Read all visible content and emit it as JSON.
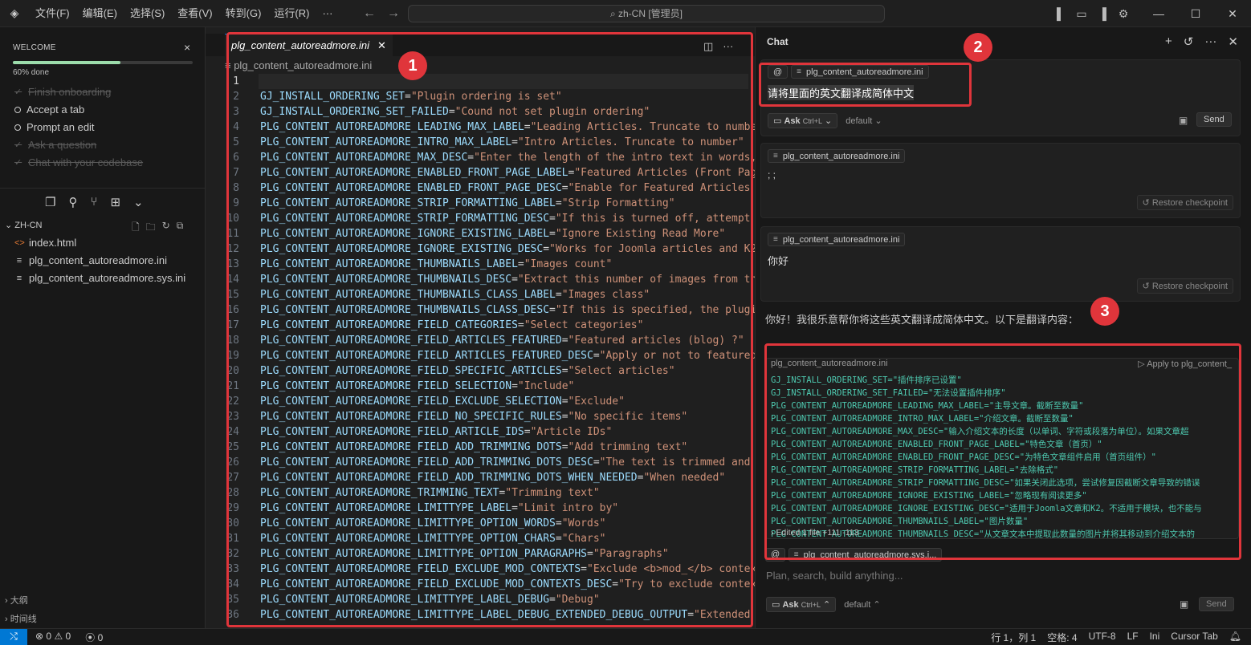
{
  "titlebar": {
    "menus": [
      "文件(F)",
      "编辑(E)",
      "选择(S)",
      "查看(V)",
      "转到(G)",
      "运行(R)",
      "···"
    ],
    "search": "zh-CN [管理员]"
  },
  "welcome": {
    "title": "WELCOME",
    "progress_label": "60% done",
    "progress_fraction": 0.6,
    "steps": [
      {
        "label": "Finish onboarding",
        "done": true
      },
      {
        "label": "Accept a tab",
        "done": false
      },
      {
        "label": "Prompt an edit",
        "done": false
      },
      {
        "label": "Ask a question",
        "done": true
      },
      {
        "label": "Chat with your codebase",
        "done": true
      }
    ]
  },
  "explorer": {
    "folder": "ZH-CN",
    "files": [
      {
        "name": "index.html",
        "icon": "html-icon"
      },
      {
        "name": "plg_content_autoreadmore.ini",
        "icon": "ini-file-icon"
      },
      {
        "name": "plg_content_autoreadmore.sys.ini",
        "icon": "ini-file-icon"
      }
    ],
    "outline": "大纲",
    "timeline": "时间线"
  },
  "editor": {
    "tab": "plg_content_autoreadmore.ini",
    "breadcrumb": "plg_content_autoreadmore.ini",
    "lines": [
      [
        "",
        ""
      ],
      [
        "GJ_INSTALL_ORDERING_SET",
        "\"Plugin ordering is set\""
      ],
      [
        "GJ_INSTALL_ORDERING_SET_FAILED",
        "\"Cound not set plugin ordering\""
      ],
      [
        "PLG_CONTENT_AUTOREADMORE_LEADING_MAX_LABEL",
        "\"Leading Articles. Truncate to numbe"
      ],
      [
        "PLG_CONTENT_AUTOREADMORE_INTRO_MAX_LABEL",
        "\"Intro Articles. Truncate to number\""
      ],
      [
        "PLG_CONTENT_AUTOREADMORE_MAX_DESC",
        "\"Enter the length of the intro text in words,"
      ],
      [
        "PLG_CONTENT_AUTOREADMORE_ENABLED_FRONT_PAGE_LABEL",
        "\"Featured Articles (Front Pag"
      ],
      [
        "PLG_CONTENT_AUTOREADMORE_ENABLED_FRONT_PAGE_DESC",
        "\"Enable for Featured Articles"
      ],
      [
        "PLG_CONTENT_AUTOREADMORE_STRIP_FORMATTING_LABEL",
        "\"Strip Formatting\""
      ],
      [
        "PLG_CONTENT_AUTOREADMORE_STRIP_FORMATTING_DESC",
        "\"If this is turned off, attempt"
      ],
      [
        "PLG_CONTENT_AUTOREADMORE_IGNORE_EXISTING_LABEL",
        "\"Ignore Existing Read More\""
      ],
      [
        "PLG_CONTENT_AUTOREADMORE_IGNORE_EXISTING_DESC",
        "\"Works for Joomla articles and K2"
      ],
      [
        "PLG_CONTENT_AUTOREADMORE_THUMBNAILS_LABEL",
        "\"Images count\""
      ],
      [
        "PLG_CONTENT_AUTOREADMORE_THUMBNAILS_DESC",
        "\"Extract this number of images from th"
      ],
      [
        "PLG_CONTENT_AUTOREADMORE_THUMBNAILS_CLASS_LABEL",
        "\"Images class\""
      ],
      [
        "PLG_CONTENT_AUTOREADMORE_THUMBNAILS_CLASS_DESC",
        "\"If this is specified, the plugi"
      ],
      [
        "PLG_CONTENT_AUTOREADMORE_FIELD_CATEGORIES",
        "\"Select categories\""
      ],
      [
        "PLG_CONTENT_AUTOREADMORE_FIELD_ARTICLES_FEATURED",
        "\"Featured articles (blog) ?\""
      ],
      [
        "PLG_CONTENT_AUTOREADMORE_FIELD_ARTICLES_FEATURED_DESC",
        "\"Apply or not to featured"
      ],
      [
        "PLG_CONTENT_AUTOREADMORE_FIELD_SPECIFIC_ARTICLES",
        "\"Select articles\""
      ],
      [
        "PLG_CONTENT_AUTOREADMORE_FIELD_SELECTION",
        "\"Include\""
      ],
      [
        "PLG_CONTENT_AUTOREADMORE_FIELD_EXCLUDE_SELECTION",
        "\"Exclude\""
      ],
      [
        "PLG_CONTENT_AUTOREADMORE_FIELD_NO_SPECIFIC_RULES",
        "\"No specific items\""
      ],
      [
        "PLG_CONTENT_AUTOREADMORE_FIELD_ARTICLE_IDS",
        "\"Article IDs\""
      ],
      [
        "PLG_CONTENT_AUTOREADMORE_FIELD_ADD_TRIMMING_DOTS",
        "\"Add trimming text\""
      ],
      [
        "PLG_CONTENT_AUTOREADMORE_FIELD_ADD_TRIMMING_DOTS_DESC",
        "\"The text is trimmed and"
      ],
      [
        "PLG_CONTENT_AUTOREADMORE_FIELD_ADD_TRIMMING_DOTS_WHEN_NEEDED",
        "\"When needed\""
      ],
      [
        "PLG_CONTENT_AUTOREADMORE_TRIMMING_TEXT",
        "\"Trimming text\""
      ],
      [
        "PLG_CONTENT_AUTOREADMORE_LIMITTYPE_LABEL",
        "\"Limit intro by\""
      ],
      [
        "PLG_CONTENT_AUTOREADMORE_LIMITTYPE_OPTION_WORDS",
        "\"Words\""
      ],
      [
        "PLG_CONTENT_AUTOREADMORE_LIMITTYPE_OPTION_CHARS",
        "\"Chars\""
      ],
      [
        "PLG_CONTENT_AUTOREADMORE_LIMITTYPE_OPTION_PARAGRAPHS",
        "\"Paragraphs\""
      ],
      [
        "PLG_CONTENT_AUTOREADMORE_FIELD_EXCLUDE_MOD_CONTEXTS",
        "\"Exclude <b>mod_</b> contex"
      ],
      [
        "PLG_CONTENT_AUTOREADMORE_FIELD_EXCLUDE_MOD_CONTEXTS_DESC",
        "\"Try to exclude contex"
      ],
      [
        "PLG_CONTENT_AUTOREADMORE_LIMITTYPE_LABEL_DEBUG",
        "\"Debug\""
      ],
      [
        "PLG_CONTENT_AUTOREADMORE_LIMITTYPE_LABEL_DEBUG_EXTENDED_DEBUG_OUTPUT",
        "\"Extended"
      ]
    ]
  },
  "chat": {
    "title": "Chat",
    "msg1": {
      "chip": "plg_content_autoreadmore.ini",
      "text": "请将里面的英文翻译成简体中文",
      "ask": "Ask",
      "shortcut": "Ctrl+L",
      "model": "default",
      "send": "Send"
    },
    "msg2": {
      "chip": "plg_content_autoreadmore.ini",
      "text": "; ;",
      "restore": "Restore checkpoint"
    },
    "msg3": {
      "chip": "plg_content_autoreadmore.ini",
      "text": "你好",
      "restore": "Restore checkpoint"
    },
    "reply": "你好！我很乐意帮你将这些英文翻译成简体中文。以下是翻译内容：",
    "code_head_file": "plg_content_autoreadmore.ini",
    "code_head_apply": "Apply to plg_content_",
    "code_lines": [
      "GJ_INSTALL_ORDERING_SET=\"插件排序已设置\"",
      "GJ_INSTALL_ORDERING_SET_FAILED=\"无法设置插件排序\"",
      "PLG_CONTENT_AUTOREADMORE_LEADING_MAX_LABEL=\"主导文章。截断至数量\"",
      "PLG_CONTENT_AUTOREADMORE_INTRO_MAX_LABEL=\"介绍文章。截断至数量\"",
      "PLG_CONTENT_AUTOREADMORE_MAX_DESC=\"输入介绍文本的长度（以单词、字符或段落为单位）。如果文章超",
      "PLG_CONTENT_AUTOREADMORE_ENABLED_FRONT_PAGE_LABEL=\"特色文章（首页）\"",
      "PLG_CONTENT_AUTOREADMORE_ENABLED_FRONT_PAGE_DESC=\"为特色文章组件启用（首页组件）\"",
      "PLG_CONTENT_AUTOREADMORE_STRIP_FORMATTING_LABEL=\"去除格式\"",
      "PLG_CONTENT_AUTOREADMORE_STRIP_FORMATTING_DESC=\"如果关闭此选项，尝试修复因截断文章导致的错误",
      "PLG_CONTENT_AUTOREADMORE_IGNORE_EXISTING_LABEL=\"忽略现有阅读更多\"",
      "PLG_CONTENT_AUTOREADMORE_IGNORE_EXISTING_DESC=\"适用于Joomla文章和K2。不适用于模块，也不能与",
      "PLG_CONTENT_AUTOREADMORE_THUMBNAILS_LABEL=\"图片数量\"",
      "PLG_CONTENT_AUTOREADMORE_THUMBNAILS_DESC=\"从文章文本中提取此数量的图片并将其移动到介绍文本的"
    ],
    "edited": "Edited 1 file +111 -113",
    "input_chip": "plg_content_autoreadmore.sys.i...",
    "placeholder": "Plan, search, build anything...",
    "ask": "Ask",
    "shortcut": "Ctrl+L",
    "model": "default",
    "send": "Send"
  },
  "annotations": [
    "1",
    "2",
    "3"
  ],
  "status": {
    "errors": "0",
    "warnings": "0",
    "ports": "0",
    "position": "行 1，列 1",
    "spaces": "空格: 4",
    "encoding": "UTF-8",
    "eol": "LF",
    "lang": "Ini",
    "tab": "Cursor Tab"
  },
  "colors": {
    "accent": "#0078d4",
    "annotation_red": "#e0353b",
    "key": "#9cdcfe",
    "string": "#ce9178"
  }
}
